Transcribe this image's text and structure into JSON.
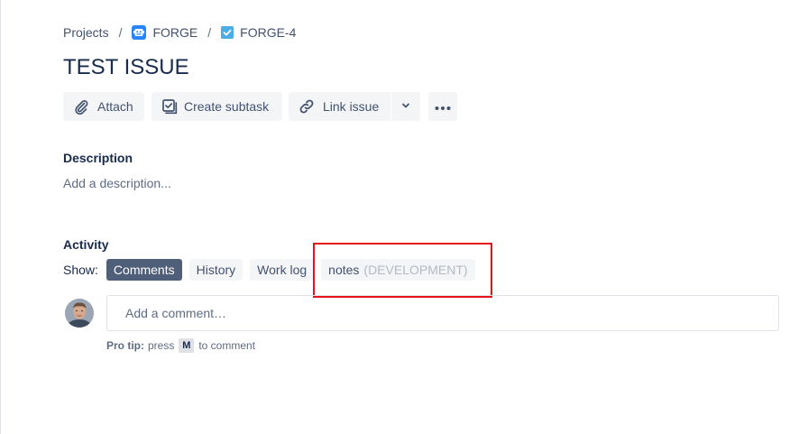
{
  "breadcrumb": {
    "projects_label": "Projects",
    "separator": "/",
    "project_label": "FORGE",
    "issue_key": "FORGE-4"
  },
  "issue": {
    "title": "TEST ISSUE"
  },
  "toolbar": {
    "attach_label": "Attach",
    "create_subtask_label": "Create subtask",
    "link_issue_label": "Link issue"
  },
  "description": {
    "heading": "Description",
    "placeholder": "Add a description..."
  },
  "activity": {
    "heading": "Activity",
    "show_label": "Show:",
    "filters": [
      {
        "label": "Comments",
        "active": true
      },
      {
        "label": "History",
        "active": false
      },
      {
        "label": "Work log",
        "active": false
      },
      {
        "label": "notes",
        "tag": "(DEVELOPMENT)",
        "active": false
      }
    ]
  },
  "comment": {
    "placeholder": "Add a comment…",
    "pro_tip_label": "Pro tip:",
    "pro_tip_before": "press",
    "pro_tip_key": "M",
    "pro_tip_after": "to comment"
  },
  "colors": {
    "accent": "#2684ff",
    "active_filter_bg": "#505f79",
    "highlight": "#e5141b"
  },
  "icons": {
    "attach": "paperclip-icon",
    "subtask": "checkbox-icon",
    "link": "link-icon",
    "dropdown": "chevron-down-icon",
    "more": "more-icon"
  }
}
